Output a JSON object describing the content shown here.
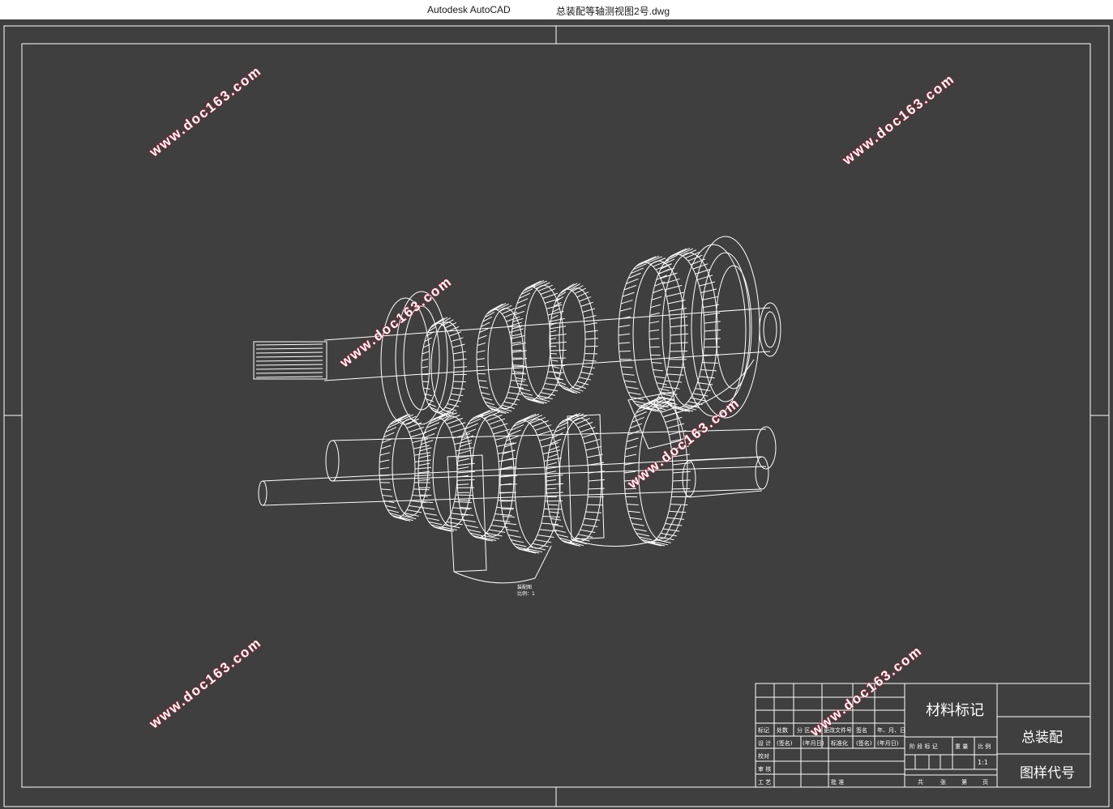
{
  "titlebar": {
    "app_name": "Autodesk AutoCAD",
    "file_name": "总装配等轴测视图2号.dwg"
  },
  "colors": {
    "canvas_background": "#3f3f3f",
    "drawing_lines": "#ffffff",
    "watermark_outline": "#c8102e"
  },
  "drawing": {
    "caption_line1": "装配图",
    "caption_line2": "比例：1"
  },
  "watermarks": [
    "www.doc163.com"
  ],
  "title_block": {
    "material_mark": "材料标记",
    "drawing_name": "总装配",
    "drawing_code": "图样代号",
    "scale_value": "1:1",
    "revision_header": {
      "mark": "标记",
      "count": "处数",
      "zone": "分 区",
      "change_doc": "更改文件号",
      "signature": "签名",
      "date": "年、月、日"
    },
    "rows": {
      "design": "设 计",
      "sign": "(签名)",
      "date": "(年月日)",
      "standardization": "标准化",
      "check": "校对",
      "review": "审 核",
      "process": "工 艺",
      "approve": "批 准"
    },
    "stage_header": {
      "stage_mark": "阶 段 标 记",
      "weight": "重 量",
      "scale": "比 例"
    },
    "sheet_footer": {
      "total": "共",
      "sheets": "张",
      "number": "第",
      "page": "页"
    }
  }
}
